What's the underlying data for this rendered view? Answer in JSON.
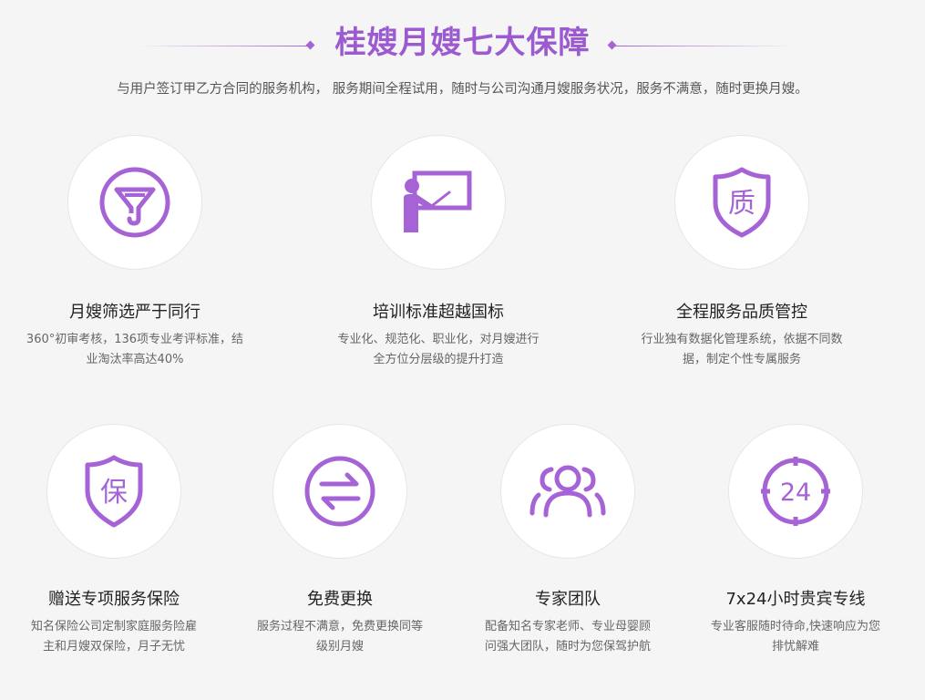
{
  "header": {
    "title": "桂嫂月嫂七大保障",
    "subtitle": "与用户签订甲乙方合同的服务机构， 服务期间全程试用，随时与公司沟通月嫂服务状况，服务不满意，随时更换月嫂。"
  },
  "theme": {
    "accent": "#a663d6",
    "background": "#f5f5f5"
  },
  "row1": [
    {
      "icon": "funnel-icon",
      "title": "月嫂筛选严于同行",
      "desc": [
        "360°初审考核，136项专业考评标准，结",
        "业淘汰率高达40%"
      ]
    },
    {
      "icon": "teacher-board-icon",
      "title": "培训标准超越国标",
      "desc": [
        "专业化、规范化、职业化，对月嫂进行",
        "全方位分层级的提升打造"
      ]
    },
    {
      "icon": "quality-shield-icon",
      "icon_text": "质",
      "title": "全程服务品质管控",
      "desc": [
        "行业独有数据化管理系统，依据不同数",
        "据，制定个性专属服务"
      ]
    }
  ],
  "row2": [
    {
      "icon": "insurance-shield-icon",
      "icon_text": "保",
      "title": "赠送专项服务保险",
      "desc": [
        "知名保险公司定制家庭服务险雇",
        "主和月嫂双保险，月子无忧"
      ]
    },
    {
      "icon": "exchange-arrows-icon",
      "title": "免费更换",
      "desc": [
        "服务过程不满意，免费更换同等",
        "级别月嫂"
      ]
    },
    {
      "icon": "team-people-icon",
      "title": "专家团队",
      "desc": [
        "配备知名专家老师、专业母婴顾",
        "问强大团队，随时为您保驾护航"
      ]
    },
    {
      "icon": "clock-24-icon",
      "icon_text": "24",
      "title": "7x24小时贵宾专线",
      "desc": [
        "专业客服随时待命,快速响应为您",
        "排忧解难"
      ]
    }
  ]
}
